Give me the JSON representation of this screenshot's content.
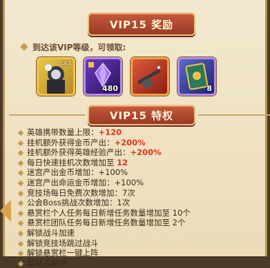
{
  "rewards": {
    "title": "VIP15 奖励",
    "subtitle": "到达该VIP等级，可领取:",
    "items": [
      {
        "name": "hero-card",
        "level": "Lv.1",
        "qty": ""
      },
      {
        "name": "purple-crystal",
        "level": "",
        "qty": "480"
      },
      {
        "name": "weapon-pack",
        "level": "",
        "qty": ""
      },
      {
        "name": "rune-card",
        "level": "",
        "qty": "8"
      }
    ]
  },
  "privileges": {
    "title": "VIP15 特权",
    "lines": [
      {
        "text": "英雄携带数量上限：",
        "value": "+120"
      },
      {
        "text": "挂机额外获得金币产出：",
        "value": "+200%"
      },
      {
        "text": "挂机额外获得英雄经验产出：",
        "value": "+200%"
      },
      {
        "text": "每日快速挂机次数增加至 ",
        "value": "12"
      },
      {
        "text": "迷宫产出金币增加：+100%",
        "value": ""
      },
      {
        "text": "迷宫产出命运金币增加：+100%",
        "value": ""
      },
      {
        "text": "竞技场每日免费次数增加：7次",
        "value": ""
      },
      {
        "text": "公会Boss挑战次数增加：1次",
        "value": ""
      },
      {
        "text": "悬赏栏个人任务每日新增任务数量增加至 10个",
        "value": ""
      },
      {
        "text": "悬赏栏团队任务每日新增任务数量增加至 2个",
        "value": ""
      },
      {
        "text": "解锁战斗加速",
        "value": ""
      },
      {
        "text": "解锁竞技场跳过战斗",
        "value": ""
      },
      {
        "text": "解锁悬赏栏一键上阵",
        "value": ""
      },
      {
        "text": "解锁占星师",
        "value": ""
      }
    ]
  }
}
